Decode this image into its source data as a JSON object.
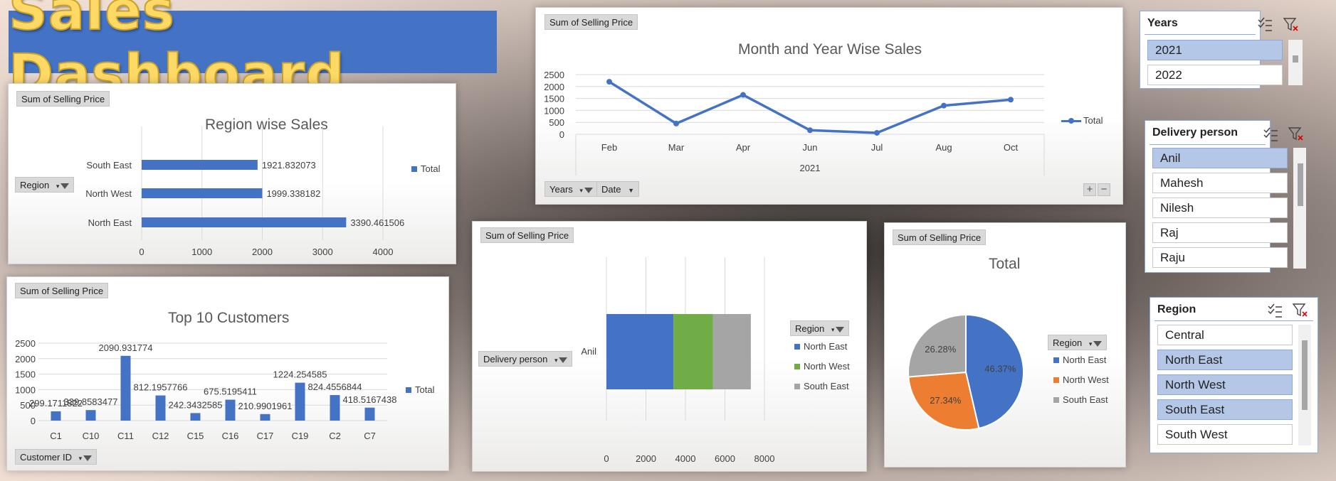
{
  "dashboard": {
    "title": "Sales Dashboard"
  },
  "colors": {
    "blue": "#4472c4",
    "green": "#70ad47",
    "gray": "#a5a5a5",
    "orange": "#ed7d31",
    "title_gold": "#ffd966"
  },
  "region_chart": {
    "field_label": "Sum of Selling Price",
    "title": "Region wise Sales",
    "axis_button": "Region",
    "legend": "Total",
    "categories": [
      "South East",
      "North West",
      "North East"
    ],
    "value_labels": [
      "1921.832073",
      "1999.338182",
      "3390.461506"
    ],
    "ticks": [
      "0",
      "1000",
      "2000",
      "3000",
      "4000"
    ]
  },
  "customers_chart": {
    "field_label": "Sum of Selling Price",
    "title": "Top 10 Customers",
    "axis_button": "Customer ID",
    "legend": "Total",
    "categories": [
      "C1",
      "C10",
      "C11",
      "C12",
      "C15",
      "C16",
      "C17",
      "C19",
      "C2",
      "C7"
    ],
    "value_labels": [
      "299.1711822",
      "339.8583477",
      "2090.931774",
      "812.1957766",
      "242.3432585",
      "675.5195411",
      "210.9901961",
      "1224.254585",
      "824.4556844",
      "418.5167438"
    ],
    "ticks": [
      "0",
      "500",
      "1000",
      "1500",
      "2000",
      "2500"
    ]
  },
  "monthly_chart": {
    "field_label": "Sum of Selling Price",
    "title": "Month and Year Wise Sales",
    "legend": "Total",
    "months": [
      "Feb",
      "Mar",
      "Apr",
      "Jun",
      "Jul",
      "Aug",
      "Oct"
    ],
    "year_label": "2021",
    "ticks": [
      "0",
      "500",
      "1000",
      "1500",
      "2000",
      "2500"
    ],
    "buttons": {
      "years": "Years",
      "date": "Date",
      "expand": "+",
      "collapse": "−"
    }
  },
  "delivery_chart": {
    "field_label": "Sum of Selling Price",
    "axis_button": "Delivery person",
    "category": "Anil",
    "legend_button": "Region",
    "legend_items": [
      "North East",
      "North West",
      "South East"
    ],
    "ticks": [
      "0",
      "2000",
      "4000",
      "6000",
      "8000"
    ]
  },
  "pie_chart": {
    "field_label": "Sum of Selling Price",
    "title": "Total",
    "legend_button": "Region",
    "legend_items": [
      "North East",
      "North West",
      "South East"
    ],
    "slice_labels": [
      "46.37%",
      "27.34%",
      "26.28%"
    ]
  },
  "slicers": {
    "years": {
      "title": "Years",
      "items": [
        "2021",
        "2022"
      ]
    },
    "delivery": {
      "title": "Delivery person",
      "items": [
        "Anil",
        "Mahesh",
        "Nilesh",
        "Raj",
        "Raju"
      ]
    },
    "region": {
      "title": "Region",
      "items": [
        "Central",
        "North East",
        "North West",
        "South East",
        "South West"
      ]
    }
  },
  "chart_data": [
    {
      "type": "bar",
      "title": "Region wise Sales",
      "categories": [
        "South East",
        "North West",
        "North East"
      ],
      "series": [
        {
          "name": "Total",
          "values": [
            1921.832073,
            1999.338182,
            3390.461506
          ]
        }
      ],
      "xlim": [
        0,
        4000
      ],
      "grid": true,
      "legend": "right"
    },
    {
      "type": "bar",
      "title": "Top 10 Customers",
      "categories": [
        "C1",
        "C10",
        "C11",
        "C12",
        "C15",
        "C16",
        "C17",
        "C19",
        "C2",
        "C7"
      ],
      "series": [
        {
          "name": "Total",
          "values": [
            299.1711822,
            339.8583477,
            2090.931774,
            812.1957766,
            242.3432585,
            675.5195411,
            210.9901961,
            1224.254585,
            824.4556844,
            418.5167438
          ]
        }
      ],
      "ylim": [
        0,
        2500
      ],
      "grid": true,
      "legend": "right"
    },
    {
      "type": "line",
      "title": "Month and Year Wise Sales",
      "categories": [
        "Feb",
        "Mar",
        "Apr",
        "Jun",
        "Jul",
        "Aug",
        "Oct"
      ],
      "series": [
        {
          "name": "Total",
          "values": [
            2200,
            450,
            1650,
            170,
            60,
            1200,
            1450
          ]
        }
      ],
      "ylim": [
        0,
        2500
      ],
      "grid": true,
      "legend": "right"
    },
    {
      "type": "bar",
      "stacked": true,
      "categories": [
        "Anil"
      ],
      "series": [
        {
          "name": "North East",
          "values": [
            3390.461506
          ]
        },
        {
          "name": "North West",
          "values": [
            1999.338182
          ]
        },
        {
          "name": "South East",
          "values": [
            1921.832073
          ]
        }
      ],
      "xlim": [
        0,
        8000
      ],
      "grid": true,
      "legend": "right"
    },
    {
      "type": "pie",
      "title": "Total",
      "categories": [
        "North East",
        "North West",
        "South East"
      ],
      "values": [
        46.37,
        27.34,
        26.28
      ],
      "legend": "right"
    }
  ]
}
